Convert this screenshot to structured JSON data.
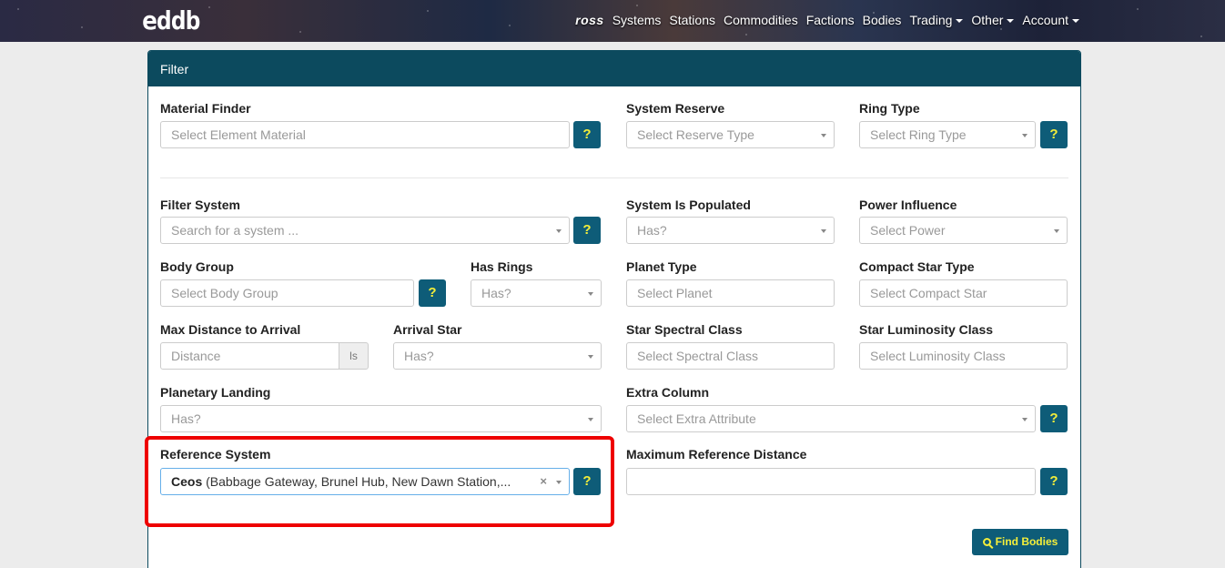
{
  "nav": {
    "logo": "eddb",
    "items": [
      "ross",
      "Systems",
      "Stations",
      "Commodities",
      "Factions",
      "Bodies",
      "Trading",
      "Other",
      "Account"
    ]
  },
  "panel": {
    "title": "Filter"
  },
  "fields": {
    "material_finder": {
      "label": "Material Finder",
      "placeholder": "Select Element Material",
      "help": "?"
    },
    "system_reserve": {
      "label": "System Reserve",
      "placeholder": "Select Reserve Type"
    },
    "ring_type": {
      "label": "Ring Type",
      "placeholder": "Select Ring Type",
      "help": "?"
    },
    "filter_system": {
      "label": "Filter System",
      "placeholder": "Search for a system ...",
      "help": "?"
    },
    "system_populated": {
      "label": "System Is Populated",
      "placeholder": "Has?"
    },
    "power_influence": {
      "label": "Power Influence",
      "placeholder": "Select Power"
    },
    "body_group": {
      "label": "Body Group",
      "placeholder": "Select Body Group",
      "help": "?"
    },
    "has_rings": {
      "label": "Has Rings",
      "placeholder": "Has?"
    },
    "planet_type": {
      "label": "Planet Type",
      "placeholder": "Select Planet"
    },
    "compact_star_type": {
      "label": "Compact Star Type",
      "placeholder": "Select Compact Star"
    },
    "max_distance": {
      "label": "Max Distance to Arrival",
      "placeholder": "Distance",
      "addon": "ls"
    },
    "arrival_star": {
      "label": "Arrival Star",
      "placeholder": "Has?"
    },
    "star_spectral": {
      "label": "Star Spectral Class",
      "placeholder": "Select Spectral Class"
    },
    "star_luminosity": {
      "label": "Star Luminosity Class",
      "placeholder": "Select Luminosity Class"
    },
    "planetary_landing": {
      "label": "Planetary Landing",
      "placeholder": "Has?"
    },
    "extra_column": {
      "label": "Extra Column",
      "placeholder": "Select Extra Attribute",
      "help": "?"
    },
    "reference_system": {
      "label": "Reference System",
      "value_name": "Ceos",
      "value_detail": " (Babbage Gateway, Brunel Hub, New Dawn Station,...",
      "clear": "×",
      "help": "?"
    },
    "max_ref_distance": {
      "label": "Maximum Reference Distance",
      "value": "",
      "help": "?"
    }
  },
  "find_button": {
    "label": "Find Bodies"
  }
}
